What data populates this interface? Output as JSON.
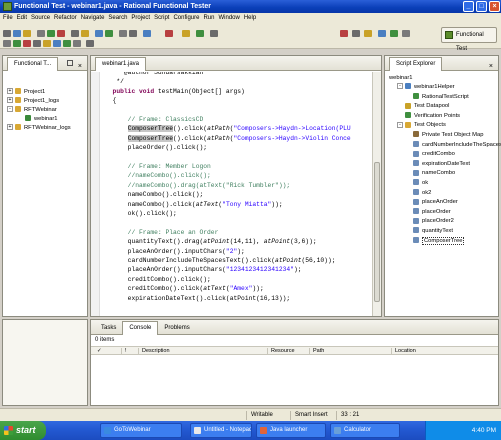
{
  "window": {
    "title": "Functional Test - webinar1.java - Rational Functional Tester"
  },
  "menu": [
    "File",
    "Edit",
    "Source",
    "Refactor",
    "Navigate",
    "Search",
    "Project",
    "Script",
    "Configure",
    "Run",
    "Window",
    "Help"
  ],
  "perspective": {
    "label": "Functional Test"
  },
  "left_view": {
    "tab_label": "Functional T...",
    "tree": [
      {
        "label": "Project1",
        "depth": 0,
        "expander": "+"
      },
      {
        "label": "Project1_logs",
        "depth": 0,
        "expander": "+"
      },
      {
        "label": "RFTWebinar",
        "depth": 0,
        "expander": "-"
      },
      {
        "label": "webinar1",
        "depth": 1,
        "expander": ""
      },
      {
        "label": "RFTWebinar_logs",
        "depth": 0,
        "expander": "+"
      }
    ]
  },
  "editor": {
    "tab_label": "webinar1.java",
    "lines": [
      {
        "segments": [
          {
            "t": "     @author Sundarsakkian",
            "c": ""
          }
        ]
      },
      {
        "segments": [
          {
            "t": "   */",
            "c": ""
          }
        ]
      },
      {
        "segments": [
          {
            "t": "  public void ",
            "c": "kw"
          },
          {
            "t": "testMain(Object[] args)",
            "c": ""
          }
        ]
      },
      {
        "segments": [
          {
            "t": "  {",
            "c": ""
          }
        ]
      },
      {
        "segments": [
          {
            "t": "",
            "c": ""
          }
        ]
      },
      {
        "segments": [
          {
            "t": "      // Frame: ClassicsCD",
            "c": "cm"
          }
        ]
      },
      {
        "segments": [
          {
            "t": "      ",
            "c": ""
          },
          {
            "t": "ComposerTree",
            "c": "hl"
          },
          {
            "t": "().click(",
            "c": ""
          },
          {
            "t": "atPath",
            "c": "it"
          },
          {
            "t": "(",
            "c": ""
          },
          {
            "t": "\"Composers->Haydn->Location(PLU",
            "c": "st"
          }
        ]
      },
      {
        "segments": [
          {
            "t": "      ",
            "c": ""
          },
          {
            "t": "ComposerTree",
            "c": "hl"
          },
          {
            "t": "().click(",
            "c": ""
          },
          {
            "t": "atPath",
            "c": "it"
          },
          {
            "t": "(",
            "c": ""
          },
          {
            "t": "\"Composers->Haydn->Violin Conce",
            "c": "st"
          }
        ]
      },
      {
        "segments": [
          {
            "t": "      placeOrder().click();",
            "c": ""
          }
        ]
      },
      {
        "segments": [
          {
            "t": "",
            "c": ""
          }
        ]
      },
      {
        "segments": [
          {
            "t": "      // Frame: Member Logon",
            "c": "cm"
          }
        ]
      },
      {
        "segments": [
          {
            "t": "      //nameCombo().click();",
            "c": "cm"
          }
        ]
      },
      {
        "segments": [
          {
            "t": "      //nameCombo().drag(atText(\"Rick Tumbler\"));",
            "c": "cm"
          }
        ]
      },
      {
        "segments": [
          {
            "t": "      nameCombo().click();",
            "c": ""
          }
        ]
      },
      {
        "segments": [
          {
            "t": "      nameCombo().click(",
            "c": ""
          },
          {
            "t": "atText",
            "c": "it"
          },
          {
            "t": "(",
            "c": ""
          },
          {
            "t": "\"Tony Miatta\"",
            "c": "st"
          },
          {
            "t": "));",
            "c": ""
          }
        ]
      },
      {
        "segments": [
          {
            "t": "      ok().click();",
            "c": ""
          }
        ]
      },
      {
        "segments": [
          {
            "t": "",
            "c": ""
          }
        ]
      },
      {
        "segments": [
          {
            "t": "      // Frame: Place an Order",
            "c": "cm"
          }
        ]
      },
      {
        "segments": [
          {
            "t": "      quantityText().drag(",
            "c": ""
          },
          {
            "t": "atPoint",
            "c": "it"
          },
          {
            "t": "(14,11), ",
            "c": ""
          },
          {
            "t": "atPoint",
            "c": "it"
          },
          {
            "t": "(3,6));",
            "c": ""
          }
        ]
      },
      {
        "segments": [
          {
            "t": "      placeAnOrder().inputChars(",
            "c": ""
          },
          {
            "t": "\"2\"",
            "c": "st"
          },
          {
            "t": ");",
            "c": ""
          }
        ]
      },
      {
        "segments": [
          {
            "t": "      cardNumberIncludeTheSpacesText().click(",
            "c": ""
          },
          {
            "t": "atPoint",
            "c": "it"
          },
          {
            "t": "(56,10));",
            "c": ""
          }
        ]
      },
      {
        "segments": [
          {
            "t": "      placeAnOrder().inputChars(",
            "c": ""
          },
          {
            "t": "\"1234123412341234\"",
            "c": "st"
          },
          {
            "t": ");",
            "c": ""
          }
        ]
      },
      {
        "segments": [
          {
            "t": "      creditCombo().click();",
            "c": ""
          }
        ]
      },
      {
        "segments": [
          {
            "t": "      creditCombo().click(",
            "c": ""
          },
          {
            "t": "atText",
            "c": "it"
          },
          {
            "t": "(",
            "c": ""
          },
          {
            "t": "\"Amex\"",
            "c": "st"
          },
          {
            "t": "));",
            "c": ""
          }
        ]
      },
      {
        "segments": [
          {
            "t": "      expirationDateText().click(atPoint(16,13));",
            "c": ""
          }
        ]
      }
    ]
  },
  "script_explorer": {
    "tab_label": "Script Explorer",
    "root": "webinar1",
    "items": [
      {
        "label": "webinar1Helper",
        "depth": 1,
        "expander": "-",
        "icon": "helper"
      },
      {
        "label": "RationalTestScript",
        "depth": 2,
        "expander": "",
        "icon": "class"
      },
      {
        "label": "Test Datapool",
        "depth": 1,
        "expander": "",
        "icon": "datapool"
      },
      {
        "label": "Verification Points",
        "depth": 1,
        "expander": "",
        "icon": "vp"
      },
      {
        "label": "Test Objects",
        "depth": 1,
        "expander": "-",
        "icon": "folder"
      },
      {
        "label": "Private Test Object Map",
        "depth": 2,
        "expander": "",
        "icon": "map"
      },
      {
        "label": "cardNumberIncludeTheSpacesText",
        "depth": 2,
        "expander": "",
        "icon": "obj"
      },
      {
        "label": "creditCombo",
        "depth": 2,
        "expander": "",
        "icon": "obj"
      },
      {
        "label": "expirationDateText",
        "depth": 2,
        "expander": "",
        "icon": "obj"
      },
      {
        "label": "nameCombo",
        "depth": 2,
        "expander": "",
        "icon": "obj"
      },
      {
        "label": "ok",
        "depth": 2,
        "expander": "",
        "icon": "obj"
      },
      {
        "label": "ok2",
        "depth": 2,
        "expander": "",
        "icon": "obj"
      },
      {
        "label": "placeAnOrder",
        "depth": 2,
        "expander": "",
        "icon": "obj"
      },
      {
        "label": "placeOrder",
        "depth": 2,
        "expander": "",
        "icon": "obj"
      },
      {
        "label": "placeOrder2",
        "depth": 2,
        "expander": "",
        "icon": "obj"
      },
      {
        "label": "quantityText",
        "depth": 2,
        "expander": "",
        "icon": "obj"
      },
      {
        "label": "ComposerTree",
        "depth": 2,
        "expander": "",
        "icon": "obj",
        "selected": true
      }
    ]
  },
  "bottom_view": {
    "tabs": [
      "Tasks",
      "Console",
      "Problems"
    ],
    "count_text": "0 items",
    "columns": [
      "✓",
      "!",
      "Description",
      "Resource",
      "Path",
      "Location"
    ]
  },
  "status": {
    "mode": "Writable",
    "insert": "Smart Insert",
    "position": "33 : 21"
  },
  "taskbar": {
    "start": "start",
    "buttons": [
      "GoToWebinar",
      "Untitled - Notepad",
      "Java launcher",
      "Calculator"
    ],
    "clock": "4:40 PM"
  },
  "colors": {
    "titlebar": "#0a3fb8",
    "taskbar": "#245ad3",
    "selection": "#3169c6",
    "keyword": "#7f0055",
    "comment": "#3f7f5f",
    "string": "#2a00ff"
  }
}
